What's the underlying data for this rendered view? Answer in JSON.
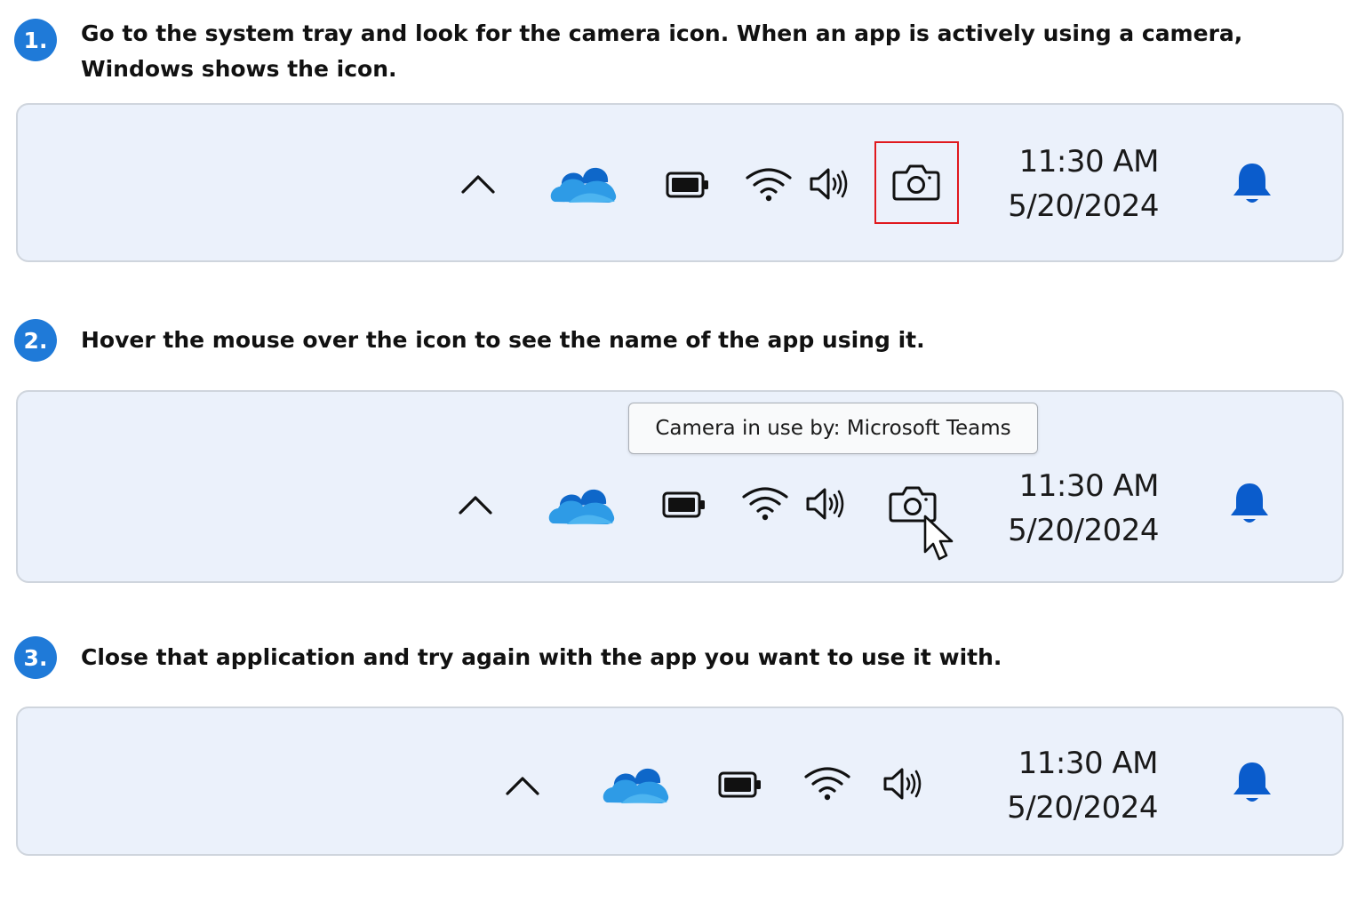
{
  "steps": [
    {
      "number": "1.",
      "text": "Go to the system tray and look for the camera icon. When an app is actively using a camera, Windows shows the icon."
    },
    {
      "number": "2.",
      "text": "Hover the mouse over the icon to see the name of the app using it."
    },
    {
      "number": "3.",
      "text": "Close that application and try again with the app you want to use it with."
    }
  ],
  "tray": {
    "time": "11:30 AM",
    "date": "5/20/2024",
    "tooltip": "Camera in use by: Microsoft Teams",
    "icons": [
      "chevron-up-icon",
      "onedrive-cloud-icon",
      "battery-icon",
      "wifi-icon",
      "volume-icon",
      "camera-icon",
      "bell-icon"
    ]
  },
  "colors": {
    "accent": "#1f7ad8",
    "highlight": "#e0191e",
    "tray_background": "#ebf1fb",
    "bell": "#0a5ccc"
  }
}
